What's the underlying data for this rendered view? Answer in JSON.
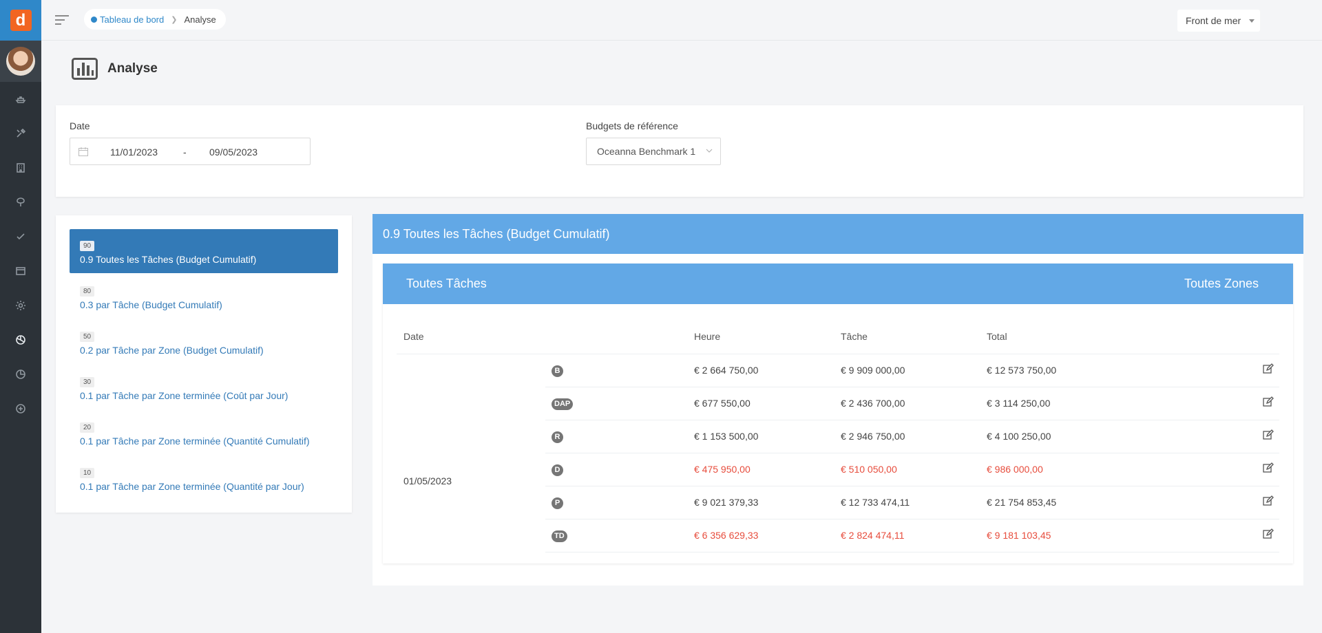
{
  "app": {
    "logo_letter": "d"
  },
  "breadcrumb": {
    "home": "Tableau de bord",
    "current": "Analyse"
  },
  "header": {
    "site": "Front de mer"
  },
  "page": {
    "title": "Analyse"
  },
  "filters": {
    "date_label": "Date",
    "date_start": "11/01/2023",
    "date_sep": "-",
    "date_end": "09/05/2023",
    "budget_label": "Budgets de référence",
    "budget_value": "Oceanna Benchmark 1"
  },
  "reports": [
    {
      "badge": "90",
      "label": "0.9 Toutes les Tâches (Budget Cumulatif)",
      "active": true
    },
    {
      "badge": "80",
      "label": "0.3 par Tâche (Budget Cumulatif)"
    },
    {
      "badge": "50",
      "label": "0.2 par Tâche par Zone (Budget Cumulatif)"
    },
    {
      "badge": "30",
      "label": "0.1 par Tâche par Zone terminée (Coût par Jour)"
    },
    {
      "badge": "20",
      "label": "0.1 par Tâche par Zone terminée (Quantité Cumulatif)"
    },
    {
      "badge": "10",
      "label": "0.1 par Tâche par Zone terminée (Quantité par Jour)"
    }
  ],
  "report": {
    "title": "0.9 Toutes les Tâches (Budget Cumulatif)",
    "scope_tasks": "Toutes Tâches",
    "scope_zones": "Toutes Zones",
    "columns": {
      "date": "Date",
      "heure": "Heure",
      "tache": "Tâche",
      "total": "Total"
    },
    "date": "01/05/2023",
    "rows": [
      {
        "code": "B",
        "heure": "€ 2 664 750,00",
        "tache": "€ 9 909 000,00",
        "total": "€ 12 573 750,00"
      },
      {
        "code": "DAP",
        "heure": "€ 677 550,00",
        "tache": "€ 2 436 700,00",
        "total": "€ 3 114 250,00"
      },
      {
        "code": "R",
        "heure": "€ 1 153 500,00",
        "tache": "€ 2 946 750,00",
        "total": "€ 4 100 250,00"
      },
      {
        "code": "D",
        "heure": "€ 475 950,00",
        "tache": "€ 510 050,00",
        "total": "€ 986 000,00",
        "negative": true
      },
      {
        "code": "P",
        "heure": "€ 9 021 379,33",
        "tache": "€ 12 733 474,11",
        "total": "€ 21 754 853,45"
      },
      {
        "code": "TD",
        "heure": "€ 6 356 629,33",
        "tache": "€ 2 824 474,11",
        "total": "€ 9 181 103,45",
        "negative": true
      }
    ]
  },
  "colors": {
    "primary": "#337ab7",
    "header_blue": "#62a8e6",
    "negative": "#e74c3c",
    "logo_orange": "#f26522",
    "sidebar": "#2c3238"
  }
}
